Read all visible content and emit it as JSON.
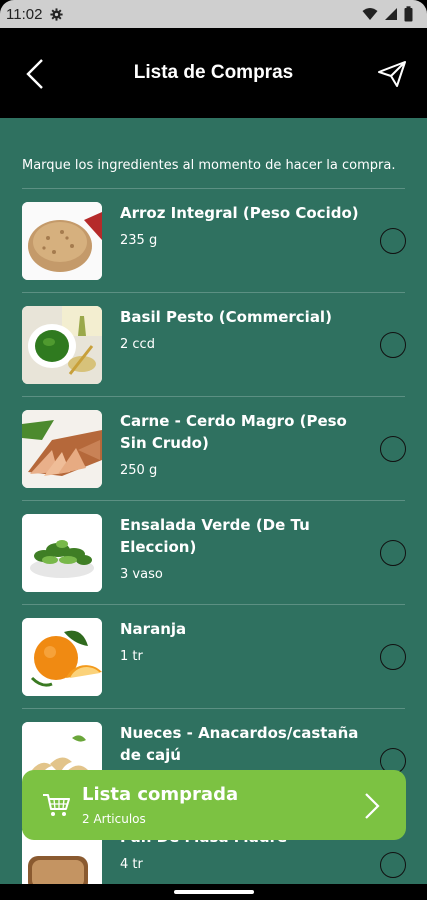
{
  "status_bar": {
    "time": "11:02"
  },
  "header": {
    "title": "Lista de Compras"
  },
  "instructions": "Marque los ingredientes al momento de hacer la compra.",
  "items": [
    {
      "name": "Arroz Integral (Peso Cocido)",
      "qty": "235 g",
      "icon": "rice-icon"
    },
    {
      "name": "Basil Pesto (Commercial)",
      "qty": "2 ccd",
      "icon": "pesto-icon"
    },
    {
      "name": "Carne - Cerdo Magro (Peso Sin Crudo)",
      "qty": "250 g",
      "icon": "pork-icon"
    },
    {
      "name": "Ensalada Verde (De Tu Eleccion)",
      "qty": "3 vaso",
      "icon": "salad-icon"
    },
    {
      "name": "Naranja",
      "qty": "1 tr",
      "icon": "orange-icon"
    },
    {
      "name": "Nueces - Anacardos/castaña de cajú",
      "qty": "",
      "icon": "cashew-icon"
    },
    {
      "name": "Pan De Masa Madre",
      "qty": "4 tr",
      "icon": "bread-icon"
    }
  ],
  "banner": {
    "label": "Lista comprada",
    "count": "2 Articulos"
  },
  "colors": {
    "background": "#2f7160",
    "banner": "#7cc242",
    "header": "#000000"
  }
}
